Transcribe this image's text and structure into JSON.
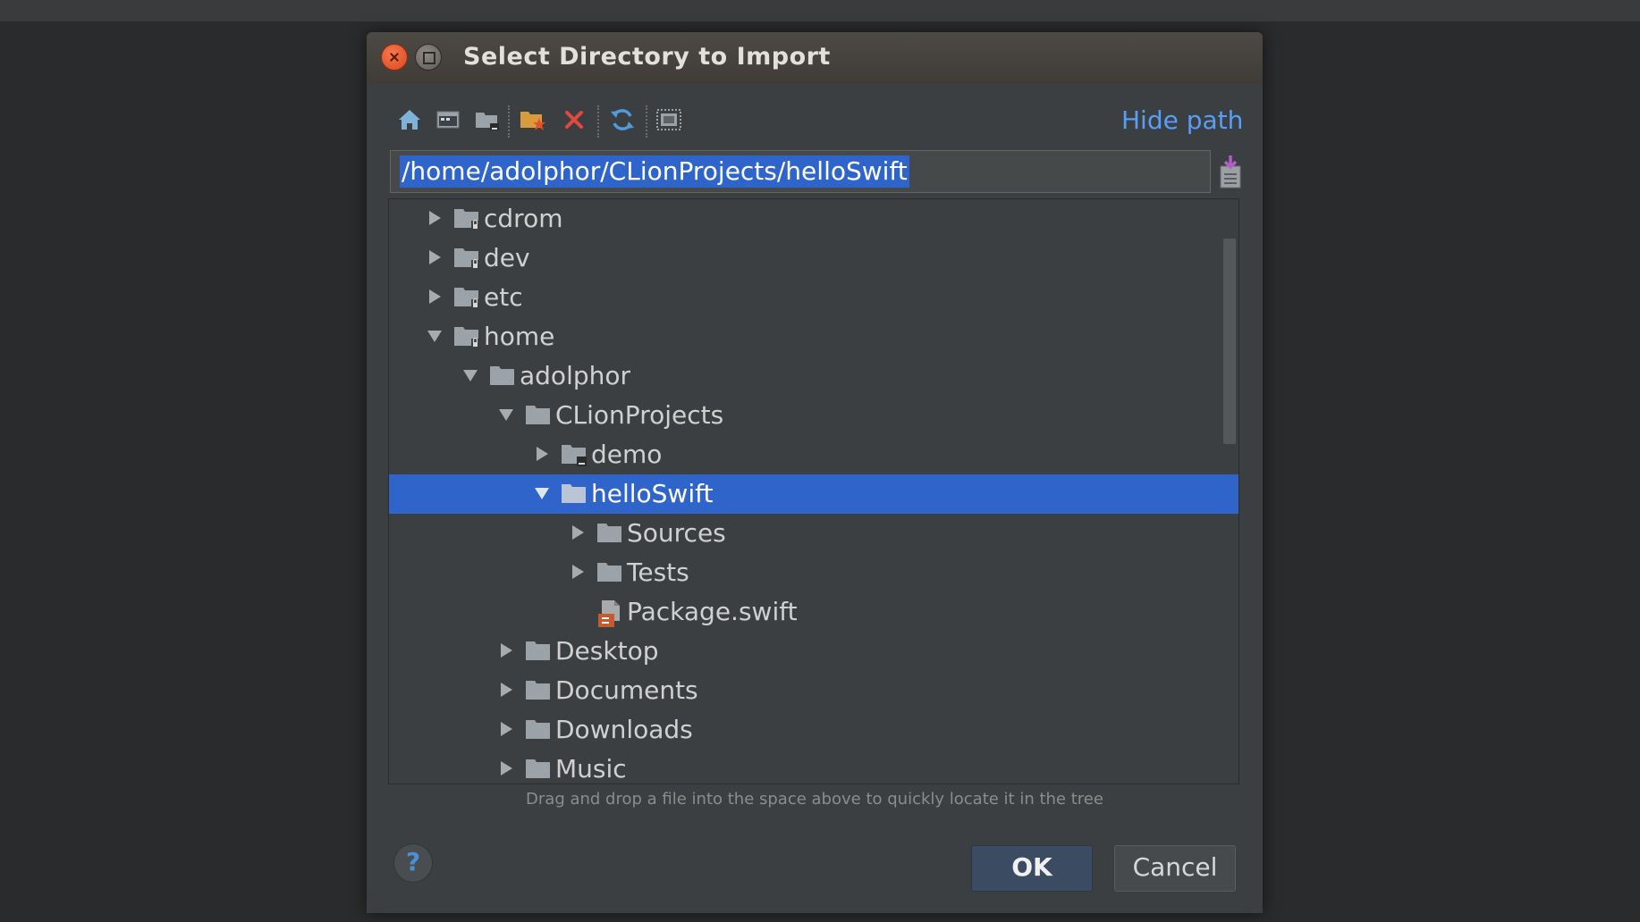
{
  "dialog": {
    "title": "Select Directory to Import",
    "hide_path_label": "Hide path",
    "path_value": "/home/adolphor/CLionProjects/helloSwift",
    "hint": "Drag and drop a file into the space above to quickly locate it in the tree",
    "ok_label": "OK",
    "cancel_label": "Cancel",
    "help_label": "?"
  },
  "toolbar": {
    "icons": [
      "home-icon",
      "desktop-icon",
      "project-folder-icon",
      "new-folder-icon",
      "delete-icon",
      "refresh-icon",
      "show-hidden-icon"
    ]
  },
  "tree": [
    {
      "label": "cdrom",
      "expanded": false,
      "type": "locked-folder"
    },
    {
      "label": "dev",
      "expanded": false,
      "type": "locked-folder"
    },
    {
      "label": "etc",
      "expanded": false,
      "type": "locked-folder"
    },
    {
      "label": "home",
      "expanded": true,
      "type": "locked-folder"
    },
    {
      "label": "adolphor",
      "expanded": true,
      "type": "folder"
    },
    {
      "label": "CLionProjects",
      "expanded": true,
      "type": "folder"
    },
    {
      "label": "demo",
      "expanded": false,
      "type": "project-folder"
    },
    {
      "label": "helloSwift",
      "expanded": true,
      "type": "folder",
      "selected": true
    },
    {
      "label": "Sources",
      "expanded": false,
      "type": "folder"
    },
    {
      "label": "Tests",
      "expanded": false,
      "type": "folder"
    },
    {
      "label": "Package.swift",
      "type": "swift-file"
    },
    {
      "label": "Desktop",
      "expanded": false,
      "type": "folder"
    },
    {
      "label": "Documents",
      "expanded": false,
      "type": "folder"
    },
    {
      "label": "Downloads",
      "expanded": false,
      "type": "folder"
    },
    {
      "label": "Music",
      "expanded": false,
      "type": "folder"
    }
  ],
  "colors": {
    "selection": "#2f65ca",
    "link": "#589df6",
    "background": "#3c3f41"
  }
}
